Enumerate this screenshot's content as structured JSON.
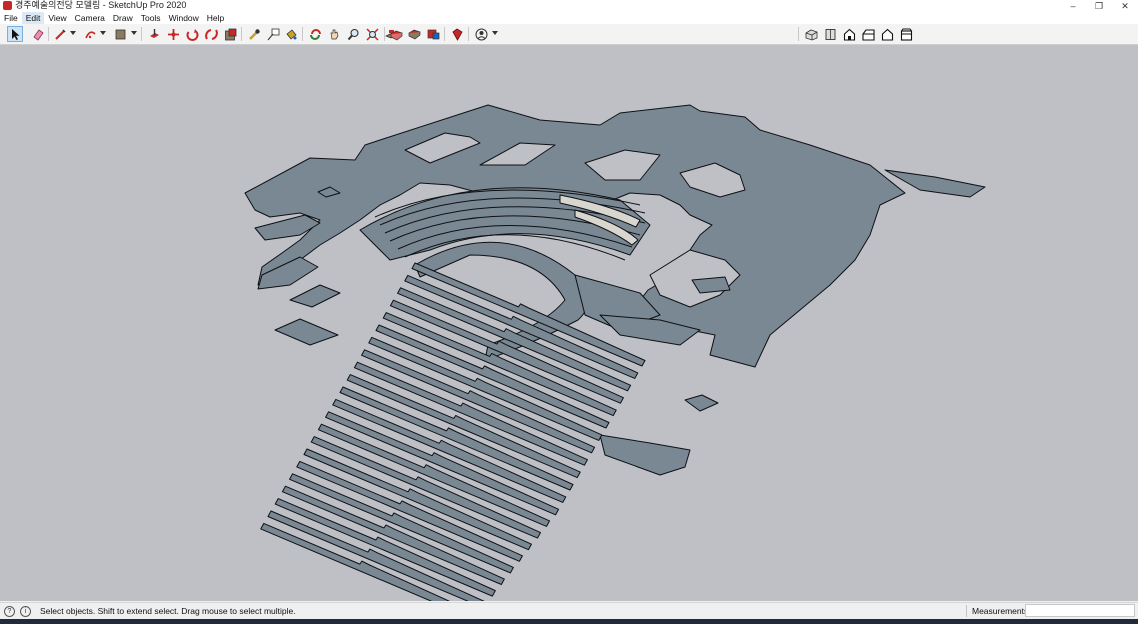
{
  "window": {
    "title": "경주예술의전당 모델링 - SketchUp Pro 2020",
    "controls": [
      "–",
      "❐",
      "✕"
    ]
  },
  "menu": {
    "items": [
      "File",
      "Edit",
      "View",
      "Camera",
      "Draw",
      "Tools",
      "Window",
      "Help"
    ],
    "active": "Edit"
  },
  "toolbar": {
    "left_tools": [
      "select-icon",
      "eraser-icon",
      "line-icon",
      "arc-icon",
      "shapes-icon",
      "push-pull-icon",
      "move-icon",
      "rotate-icon",
      "scale-icon",
      "offset-icon",
      "tape-measure-icon",
      "text-icon",
      "paint-bucket-icon",
      "orbit-icon",
      "pan-icon",
      "zoom-icon",
      "zoom-extents-icon",
      "3d-warehouse-icon",
      "extension-warehouse-icon",
      "layout-icon",
      "extension-manager-icon",
      "ruby-icon",
      "account-icon"
    ],
    "right_tools": [
      "iso-view-icon",
      "top-view-icon",
      "front-view-icon",
      "right-view-icon",
      "back-view-icon",
      "left-view-icon"
    ]
  },
  "viewport": {
    "background": "#bec0c5",
    "face_color": "#7a8893",
    "edge_color": "#0d1014",
    "light_face_color": "#d9d6cf"
  },
  "status": {
    "message": "Select objects. Shift to extend select. Drag mouse to select multiple.",
    "measurements_label": "Measurements",
    "measurements_value": ""
  }
}
